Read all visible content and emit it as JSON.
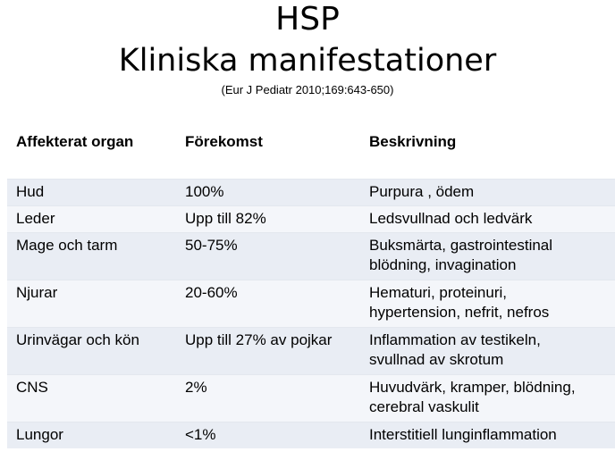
{
  "title": {
    "line1": "HSP",
    "line2": "Kliniska manifestationer",
    "citation": "(Eur J Pediatr 2010;169:643-650)"
  },
  "table": {
    "headers": [
      "Affekterat organ",
      "Förekomst",
      "Beskrivning"
    ],
    "rows": [
      {
        "organ": "Hud",
        "frequency": "100%",
        "description_lines": [
          "Purpura , ödem"
        ]
      },
      {
        "organ": "Leder",
        "frequency": "Upp till 82%",
        "description_lines": [
          "Ledsvullnad och ledvärk"
        ]
      },
      {
        "organ": "Mage och tarm",
        "frequency": "50-75%",
        "description_lines": [
          "Buksmärta, gastrointestinal",
          "blödning, invagination"
        ]
      },
      {
        "organ": "Njurar",
        "frequency": "20-60%",
        "description_lines": [
          "Hematuri, proteinuri,",
          "hypertension, nefrit,  nefros"
        ]
      },
      {
        "organ": "Urinvägar och kön",
        "frequency": "Upp till 27% av pojkar",
        "description_lines": [
          "Inflammation av testikeln,",
          "svullnad av skrotum"
        ]
      },
      {
        "organ": "CNS",
        "frequency": "2%",
        "description_lines": [
          "Huvudvärk, kramper, blödning,",
          "cerebral vaskulit"
        ]
      },
      {
        "organ": "Lungor",
        "frequency": "<1%",
        "description_lines": [
          "Interstitiell lunginflammation"
        ]
      }
    ]
  },
  "colors": {
    "header_bg": "#ffffff",
    "row_odd_bg": "#e9edf4",
    "row_even_bg": "#f4f6fa"
  }
}
